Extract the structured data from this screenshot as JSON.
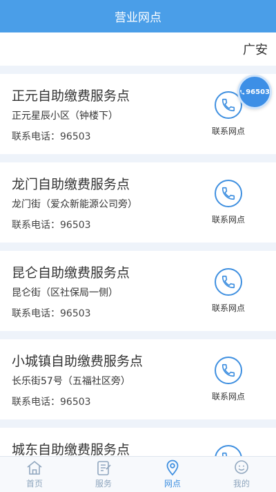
{
  "header": {
    "title": "营业网点"
  },
  "city": {
    "name": "广安"
  },
  "outlets": [
    {
      "name": "正元自助缴费服务点",
      "address": "正元星辰小区（钟楼下）",
      "phone": "联系电话：96503",
      "contact_label": "联系网点"
    },
    {
      "name": "龙门自助缴费服务点",
      "address": "龙门街（爱众新能源公司旁）",
      "phone": "联系电话：96503",
      "contact_label": "联系网点"
    },
    {
      "name": "昆仑自助缴费服务点",
      "address": "昆仑街（区社保局一侧）",
      "phone": "联系电话：96503",
      "contact_label": "联系网点"
    },
    {
      "name": "小城镇自助缴费服务点",
      "address": "长乐街57号（五福社区旁）",
      "phone": "联系电话：96503",
      "contact_label": "联系网点"
    },
    {
      "name": "城东自助缴费服务点",
      "address": "",
      "phone": "",
      "contact_label": ""
    }
  ],
  "hotline": {
    "number": "96503",
    "icon": "phone-icon"
  },
  "tabs": [
    {
      "label": "首页",
      "icon": "home-icon",
      "active": false
    },
    {
      "label": "服务",
      "icon": "clipboard-icon",
      "active": false
    },
    {
      "label": "网点",
      "icon": "location-pin-icon",
      "active": true
    },
    {
      "label": "我的",
      "icon": "user-face-icon",
      "active": false
    }
  ],
  "colors": {
    "primary": "#4a9ee8",
    "accent": "#3e8fe0",
    "background": "#eef3fa",
    "tab_inactive": "#8fa6be"
  }
}
